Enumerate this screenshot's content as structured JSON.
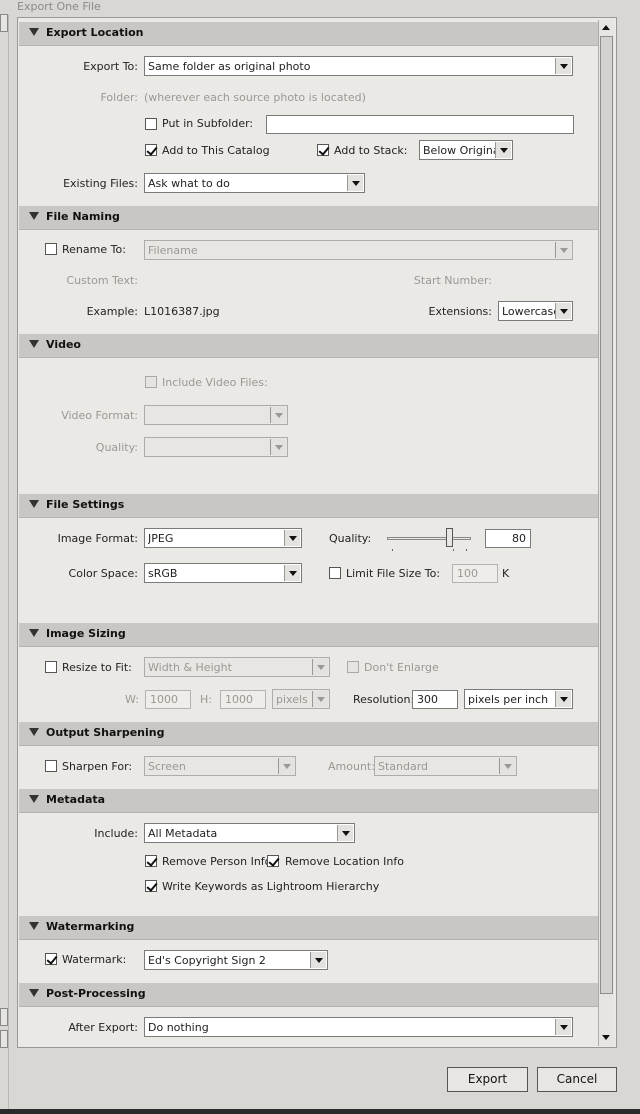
{
  "window": {
    "title": "Export One File"
  },
  "export_location": {
    "header": "Export Location",
    "export_to_label": "Export To:",
    "export_to_value": "Same folder as original photo",
    "folder_label": "Folder:",
    "folder_value": "(wherever each source photo is located)",
    "subfolder_label": "Put in Subfolder:",
    "subfolder_value": "",
    "add_catalog_label": "Add to This Catalog",
    "add_stack_label": "Add to Stack:",
    "stack_value": "Below Original",
    "existing_label": "Existing Files:",
    "existing_value": "Ask what to do"
  },
  "file_naming": {
    "header": "File Naming",
    "rename_label": "Rename To:",
    "rename_value": "Filename",
    "custom_text_label": "Custom Text:",
    "start_number_label": "Start Number:",
    "example_label": "Example:",
    "example_value": "L1016387.jpg",
    "extensions_label": "Extensions:",
    "extensions_value": "Lowercase"
  },
  "video": {
    "header": "Video",
    "include_label": "Include Video Files:",
    "format_label": "Video Format:",
    "format_value": "",
    "quality_label": "Quality:",
    "quality_value": ""
  },
  "file_settings": {
    "header": "File Settings",
    "image_format_label": "Image Format:",
    "image_format_value": "JPEG",
    "quality_label": "Quality:",
    "quality_value": "80",
    "quality_level": 80,
    "color_space_label": "Color Space:",
    "color_space_value": "sRGB",
    "limit_label": "Limit File Size To:",
    "limit_value": "100",
    "limit_unit": "K"
  },
  "image_sizing": {
    "header": "Image Sizing",
    "resize_label": "Resize to Fit:",
    "resize_value": "Width & Height",
    "dont_enlarge_label": "Don't Enlarge",
    "w_label": "W:",
    "w_value": "1000",
    "h_label": "H:",
    "h_value": "1000",
    "units_value": "pixels",
    "resolution_label": "Resolution:",
    "resolution_value": "300",
    "resolution_unit": "pixels per inch"
  },
  "output_sharpening": {
    "header": "Output Sharpening",
    "sharpen_label": "Sharpen For:",
    "sharpen_value": "Screen",
    "amount_label": "Amount:",
    "amount_value": "Standard"
  },
  "metadata": {
    "header": "Metadata",
    "include_label": "Include:",
    "include_value": "All Metadata",
    "remove_person_label": "Remove Person Info",
    "remove_location_label": "Remove Location Info",
    "keywords_label": "Write Keywords as Lightroom Hierarchy"
  },
  "watermarking": {
    "header": "Watermarking",
    "watermark_label": "Watermark:",
    "watermark_value": "Ed's Copyright Sign 2"
  },
  "post_processing": {
    "header": "Post-Processing",
    "after_label": "After Export:",
    "after_value": "Do nothing"
  },
  "buttons": {
    "export": "Export",
    "cancel": "Cancel"
  }
}
